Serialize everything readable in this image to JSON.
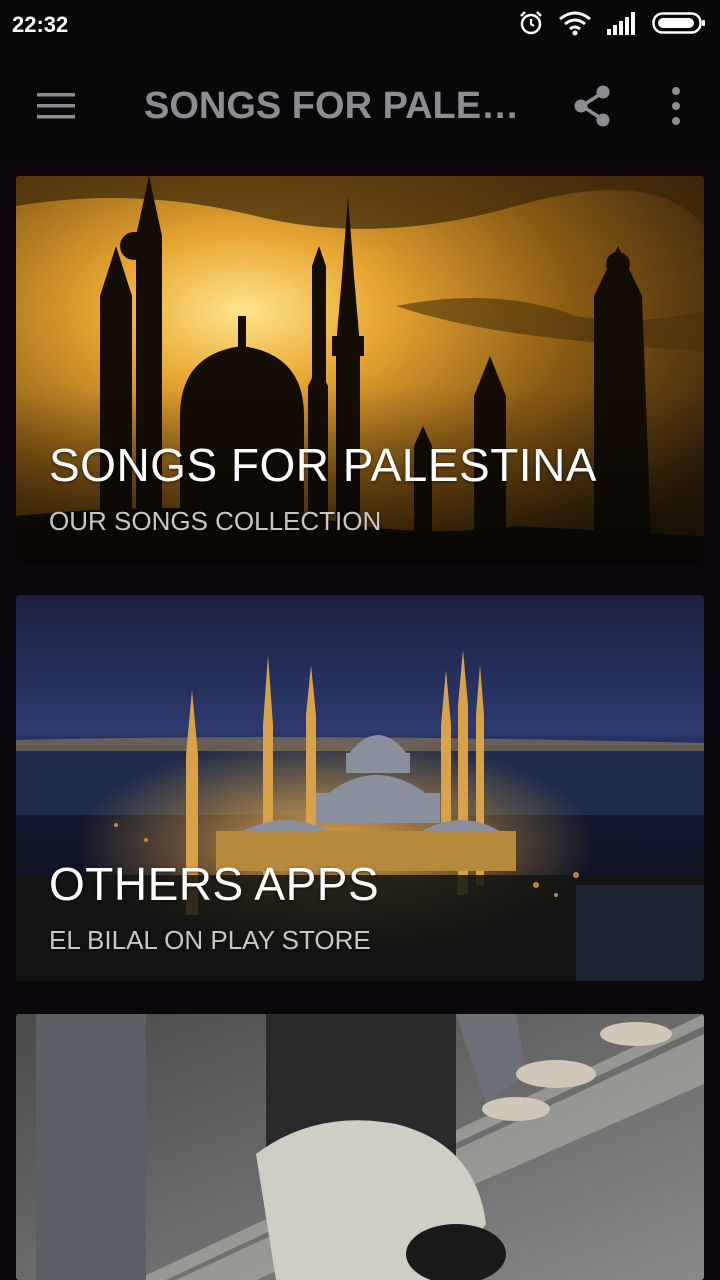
{
  "status_bar": {
    "time": "22:32",
    "icons": [
      "alarm-icon",
      "wifi-icon",
      "signal-icon",
      "battery-icon"
    ]
  },
  "app_bar": {
    "title": "SONGS FOR PALES...",
    "icons": [
      "menu-icon",
      "share-icon",
      "more-vert-icon"
    ]
  },
  "cards": [
    {
      "title": "SONGS FOR PALESTINA",
      "subtitle": "OUR SONGS COLLECTION"
    },
    {
      "title": "OTHERS APPS",
      "subtitle": "EL BILAL ON PLAY STORE"
    },
    {
      "title": "",
      "subtitle": ""
    }
  ],
  "colors": {
    "background": "#0b070d",
    "app_bar": "#0a070b",
    "title_text": "#8e8c90",
    "card_text": "#ffffff"
  }
}
